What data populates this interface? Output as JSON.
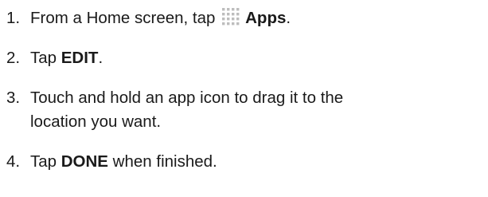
{
  "steps": [
    {
      "number": "1.",
      "text_before": "From a Home screen, tap ",
      "icon": "apps-grid-icon",
      "bold": "Apps",
      "text_after": "."
    },
    {
      "number": "2.",
      "text_before": "Tap ",
      "bold": "EDIT",
      "text_after": "."
    },
    {
      "number": "3.",
      "line1": "Touch and hold an app icon to drag it to the",
      "line2": "location you want."
    },
    {
      "number": "4.",
      "text_before": "Tap ",
      "bold": "DONE",
      "text_after": " when finished."
    }
  ],
  "colors": {
    "text": "#1a1a1a",
    "icon_dots": "#bdbdbd"
  }
}
